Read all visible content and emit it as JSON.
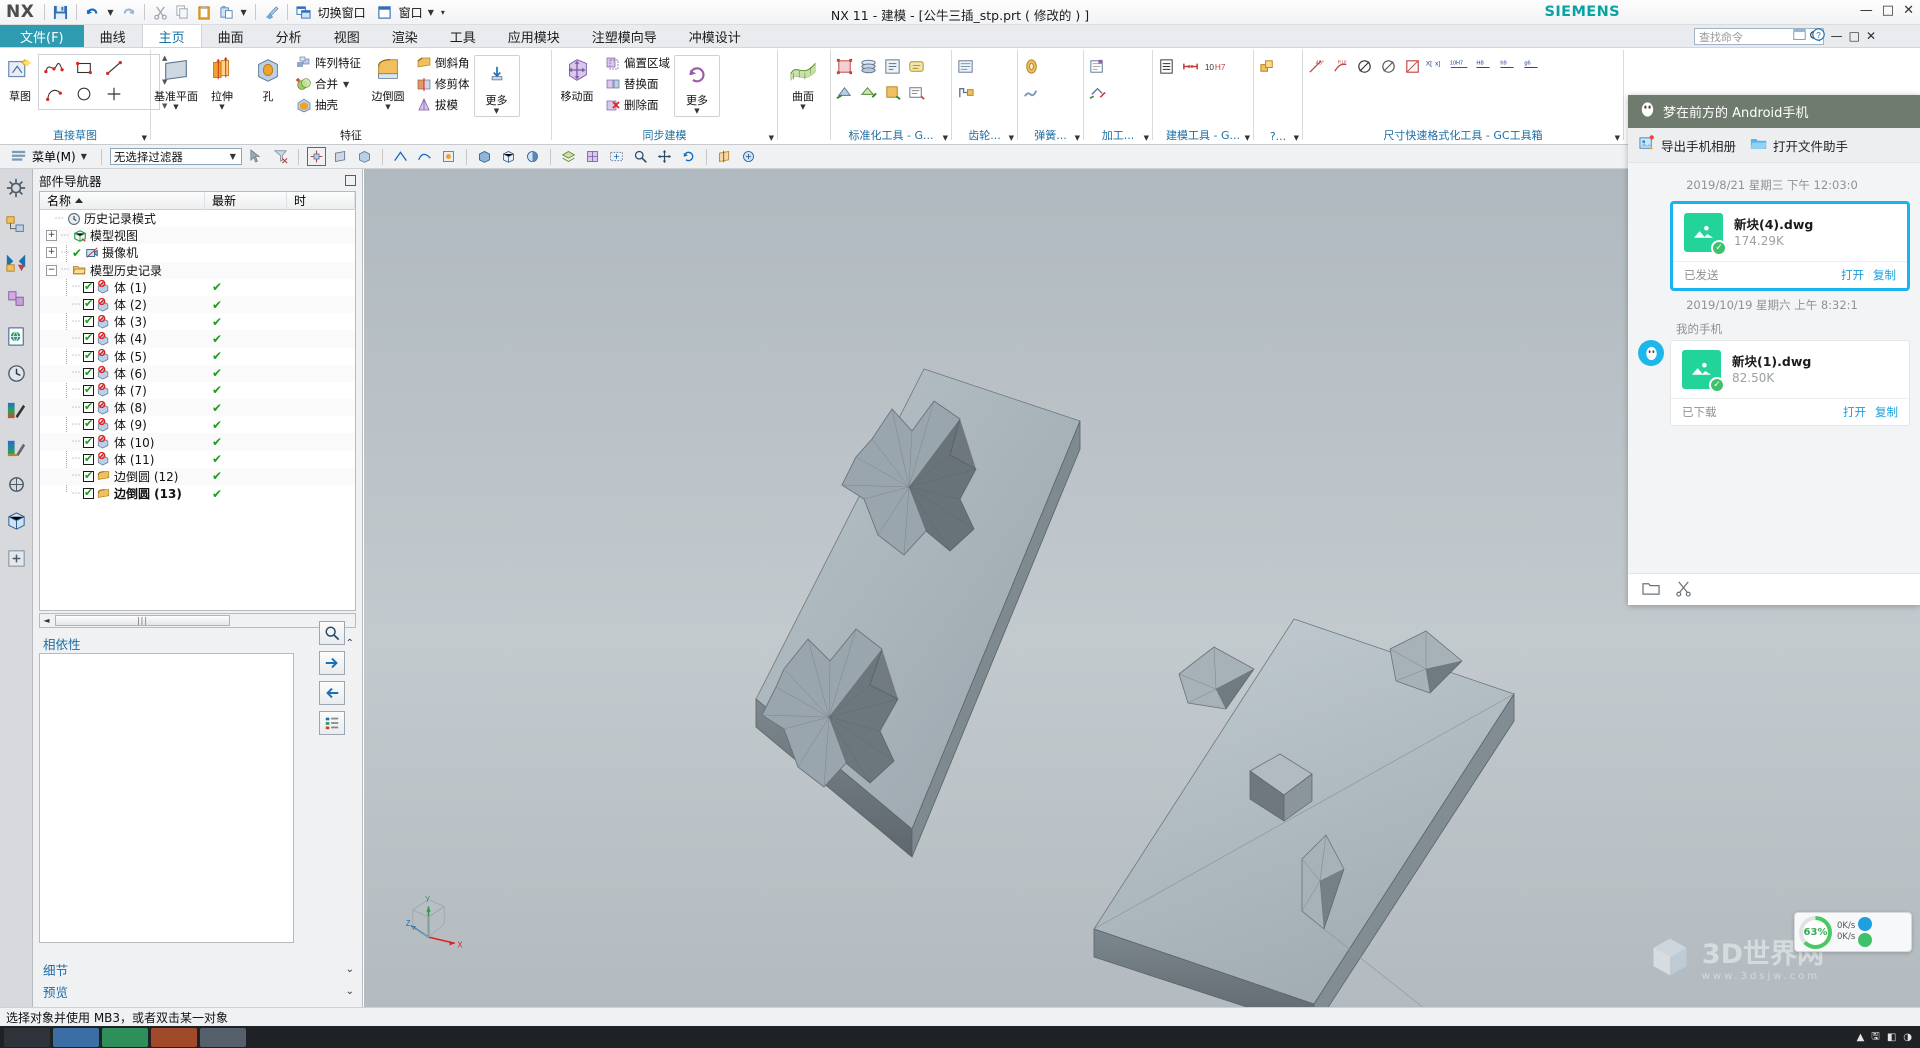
{
  "window": {
    "app_name": "NX",
    "title": "NX 11 - 建模 - [公牛三插_stp.prt ( 修改的 ) ]",
    "vendor": "SIEMENS",
    "minimize": "—",
    "maximize": "□",
    "close": "✕"
  },
  "quick_access": {
    "save": "save-icon",
    "undo": "undo-icon",
    "redo": "redo-icon",
    "cut": "cut-icon",
    "copy": "copy-icon",
    "paste": "paste-icon",
    "paste_special": "paste-special-icon",
    "undo_brush": "brush-icon",
    "switch_window_label": "切换窗口",
    "window_label": "窗口"
  },
  "tabs": [
    {
      "label": "文件(F)",
      "active": false,
      "file": true
    },
    {
      "label": "曲线",
      "active": false
    },
    {
      "label": "主页",
      "active": true
    },
    {
      "label": "曲面",
      "active": false
    },
    {
      "label": "分析",
      "active": false
    },
    {
      "label": "视图",
      "active": false
    },
    {
      "label": "渲染",
      "active": false
    },
    {
      "label": "工具",
      "active": false
    },
    {
      "label": "应用模块",
      "active": false
    },
    {
      "label": "注塑模向导",
      "active": false
    },
    {
      "label": "冲模设计",
      "active": false
    }
  ],
  "search": {
    "placeholder": "查找命令"
  },
  "ribbon": {
    "groups": [
      {
        "caption": "直接草图",
        "caption_color": "#1c6ea4",
        "big": [
          {
            "label": "草图",
            "icon": "sketch-icon"
          }
        ],
        "grid": [
          "spline-icon",
          "rectangle-icon",
          "line-icon",
          "arc-icon",
          "circle-icon",
          "point-icon"
        ]
      },
      {
        "caption": "特征",
        "caption_color": "#1b1b1b",
        "big": [
          {
            "label": "基准平面",
            "icon": "datum-plane-icon",
            "caret": true
          },
          {
            "label": "拉伸",
            "icon": "extrude-icon",
            "caret": true
          },
          {
            "label": "孔",
            "icon": "hole-icon"
          }
        ],
        "small": [
          {
            "label": "阵列特征",
            "icon": "pattern-feature-icon"
          },
          {
            "label": "合并",
            "icon": "unite-icon",
            "caret": true
          },
          {
            "label": "抽壳",
            "icon": "shell-icon"
          }
        ],
        "big2": [
          {
            "label": "边倒圆",
            "icon": "edge-blend-icon",
            "caret": true
          }
        ],
        "small2": [
          {
            "label": "倒斜角",
            "icon": "chamfer-icon"
          },
          {
            "label": "修剪体",
            "icon": "trim-body-icon"
          },
          {
            "label": "拔模",
            "icon": "draft-icon"
          }
        ],
        "more": {
          "label": "更多",
          "icon": "more-features-icon",
          "caret": true
        }
      },
      {
        "caption": "同步建模",
        "caption_color": "#1c6ea4",
        "big": [
          {
            "label": "移动面",
            "icon": "move-face-icon"
          }
        ],
        "small": [
          {
            "label": "偏置区域",
            "icon": "offset-region-icon"
          },
          {
            "label": "替换面",
            "icon": "replace-face-icon"
          },
          {
            "label": "删除面",
            "icon": "delete-face-icon"
          }
        ],
        "more": {
          "label": "更多",
          "icon": "more-sync-icon",
          "caret": true
        }
      },
      {
        "caption": "",
        "caption_color": "#1b1b1b",
        "big": [
          {
            "label": "曲面",
            "icon": "surface-icon",
            "caret": true
          }
        ]
      },
      {
        "caption": "标准化工具 - G...",
        "caption_color": "#1c6ea4",
        "icons": [
          "std-tool-1",
          "std-tool-2",
          "std-tool-3",
          "std-tool-4",
          "std-tool-5",
          "std-tool-6",
          "std-tool-7",
          "std-tool-8"
        ]
      },
      {
        "caption": "齿轮...",
        "caption_color": "#1c6ea4",
        "icons": [
          "gear-1",
          "gear-2"
        ]
      },
      {
        "caption": "弹簧...",
        "caption_color": "#1c6ea4",
        "icons": [
          "spring-1",
          "spring-2"
        ]
      },
      {
        "caption": "加工...",
        "caption_color": "#1c6ea4",
        "icons": [
          "mach-1",
          "mach-2"
        ]
      },
      {
        "caption": "建模工具 - G...",
        "caption_color": "#1c6ea4",
        "icons": [
          "model-1",
          "model-2",
          "model-3"
        ]
      },
      {
        "caption": "?...",
        "caption_color": "#1c6ea4",
        "icons": [
          "misc-1",
          "misc-2",
          "misc-3"
        ]
      },
      {
        "caption": "尺寸快速格式化工具 - GC工具箱",
        "caption_color": "#1c6ea4",
        "icons": [
          "dim-1",
          "dim-2",
          "dim-3",
          "dim-4",
          "dim-5",
          "dim-6",
          "dim-7",
          "dim-8",
          "dim-9",
          "dim-10"
        ]
      }
    ]
  },
  "menubar": {
    "menu_label": "菜单(M)",
    "filter_value": "无选择过滤器",
    "icons": [
      "select-icon",
      "filter-clear-icon",
      "point-snap-icon",
      "face-select-icon",
      "body-select-icon",
      "edge-select-icon",
      "curve-select-icon",
      "feature-select-icon",
      "shaded-icon",
      "wireframe-icon",
      "render-style-icon",
      "layer-icon",
      "orient-icon",
      "fit-icon",
      "zoom-icon",
      "pan-icon",
      "rotate-icon",
      "section-icon",
      "more-view-icon"
    ]
  },
  "resource_bar": {
    "items": [
      {
        "name": "assembly-navigator",
        "icon": "gear-nav-icon"
      },
      {
        "name": "part-navigator",
        "icon": "part-nav-icon",
        "selected": true
      },
      {
        "name": "constraint-navigator",
        "icon": "constraint-icon"
      },
      {
        "name": "reuse-library",
        "icon": "reuse-icon"
      },
      {
        "name": "hd3d-tools",
        "icon": "hd3d-icon"
      },
      {
        "name": "web-browser",
        "icon": "browser-icon"
      },
      {
        "name": "history",
        "icon": "history-icon"
      },
      {
        "name": "palettes",
        "icon": "palette-icon"
      },
      {
        "name": "roles",
        "icon": "roles-icon"
      },
      {
        "name": "system-scene",
        "icon": "scene-icon"
      }
    ]
  },
  "part_navigator": {
    "title": "部件导航器",
    "columns": [
      "名称",
      "最新",
      "时"
    ],
    "rows": [
      {
        "label": "历史记录模式",
        "icon": "clock-icon",
        "check": false,
        "checkbox": false,
        "indent": 0,
        "expander": "",
        "updated": ""
      },
      {
        "label": "模型视图",
        "icon": "model-view-icon",
        "check": false,
        "checkbox": false,
        "indent": 0,
        "expander": "+",
        "updated": ""
      },
      {
        "label": "摄像机",
        "icon": "camera-icon",
        "check": false,
        "checkbox": false,
        "indent": 0,
        "expander": "+",
        "updated": "",
        "prefix_check": true
      },
      {
        "label": "模型历史记录",
        "icon": "folder-icon",
        "check": false,
        "checkbox": false,
        "indent": 0,
        "expander": "−",
        "updated": ""
      },
      {
        "label": "体 (1)",
        "icon": "body-icon",
        "checkbox": true,
        "indent": 1,
        "updated": "✔"
      },
      {
        "label": "体 (2)",
        "icon": "body-icon",
        "checkbox": true,
        "indent": 1,
        "updated": "✔"
      },
      {
        "label": "体 (3)",
        "icon": "body-icon",
        "checkbox": true,
        "indent": 1,
        "updated": "✔"
      },
      {
        "label": "体 (4)",
        "icon": "body-icon",
        "checkbox": true,
        "indent": 1,
        "updated": "✔"
      },
      {
        "label": "体 (5)",
        "icon": "body-icon",
        "checkbox": true,
        "indent": 1,
        "updated": "✔"
      },
      {
        "label": "体 (6)",
        "icon": "body-icon",
        "checkbox": true,
        "indent": 1,
        "updated": "✔"
      },
      {
        "label": "体 (7)",
        "icon": "body-icon",
        "checkbox": true,
        "indent": 1,
        "updated": "✔"
      },
      {
        "label": "体 (8)",
        "icon": "body-icon",
        "checkbox": true,
        "indent": 1,
        "updated": "✔"
      },
      {
        "label": "体 (9)",
        "icon": "body-icon",
        "checkbox": true,
        "indent": 1,
        "updated": "✔"
      },
      {
        "label": "体 (10)",
        "icon": "body-icon",
        "checkbox": true,
        "indent": 1,
        "updated": "✔"
      },
      {
        "label": "体 (11)",
        "icon": "body-icon",
        "checkbox": true,
        "indent": 1,
        "updated": "✔"
      },
      {
        "label": "边倒圆 (12)",
        "icon": "edge-blend-feature-icon",
        "checkbox": true,
        "indent": 1,
        "updated": "✔"
      },
      {
        "label": "边倒圆 (13)",
        "icon": "edge-blend-feature-icon",
        "checkbox": true,
        "indent": 1,
        "updated": "✔",
        "bold": true
      }
    ]
  },
  "dependencies": {
    "title": "相依性",
    "buttons": [
      "search-icon",
      "forward-icon",
      "back-icon",
      "list-icon"
    ]
  },
  "details": {
    "title": "细节"
  },
  "preview": {
    "title": "预览"
  },
  "status_bar": {
    "message": "选择对象并使用 MB3，或者双击某一对象"
  },
  "qq_panel": {
    "title": "梦在前方的 Android手机",
    "title_icon": "penguin-icon",
    "toolbar": [
      {
        "label": "导出手机相册",
        "icon": "export-album-icon"
      },
      {
        "label": "打开文件助手",
        "icon": "open-folder-icon"
      }
    ],
    "messages": [
      {
        "timestamp": "2019/8/21 星期三 下午 12:03:0",
        "sender": "",
        "show_avatar": false,
        "selected": true,
        "file_name": "新块(4).dwg",
        "file_size": "174.29K",
        "status": "已发送",
        "actions": [
          "打开",
          "复制"
        ]
      },
      {
        "timestamp": "2019/10/19 星期六 上午 8:32:1",
        "sender": "我的手机",
        "show_avatar": true,
        "selected": false,
        "file_name": "新块(1).dwg",
        "file_size": "82.50K",
        "status": "已下载",
        "actions": [
          "打开",
          "复制"
        ]
      }
    ],
    "bottom_icons": [
      "folder-icon",
      "scissors-icon"
    ]
  },
  "download_widget": {
    "percent": "63%",
    "up_speed": "0K/s",
    "down_speed": "0K/s"
  },
  "watermark": {
    "text": "3D世界网",
    "sub": "www.3dsjw.com",
    "icon": "cube-icon"
  },
  "csys": {
    "x": "X",
    "y": "Y",
    "z": "Z"
  },
  "colors": {
    "accent_teal": "#2e9bb0",
    "link_blue": "#1c6ea4",
    "qq_blue": "#19b3f0",
    "green_check": "#1a9e1a",
    "ribbon_bg": "#ffffff",
    "panel_bg": "#f0f1f3",
    "graphics_bg": "#b6bec3"
  }
}
